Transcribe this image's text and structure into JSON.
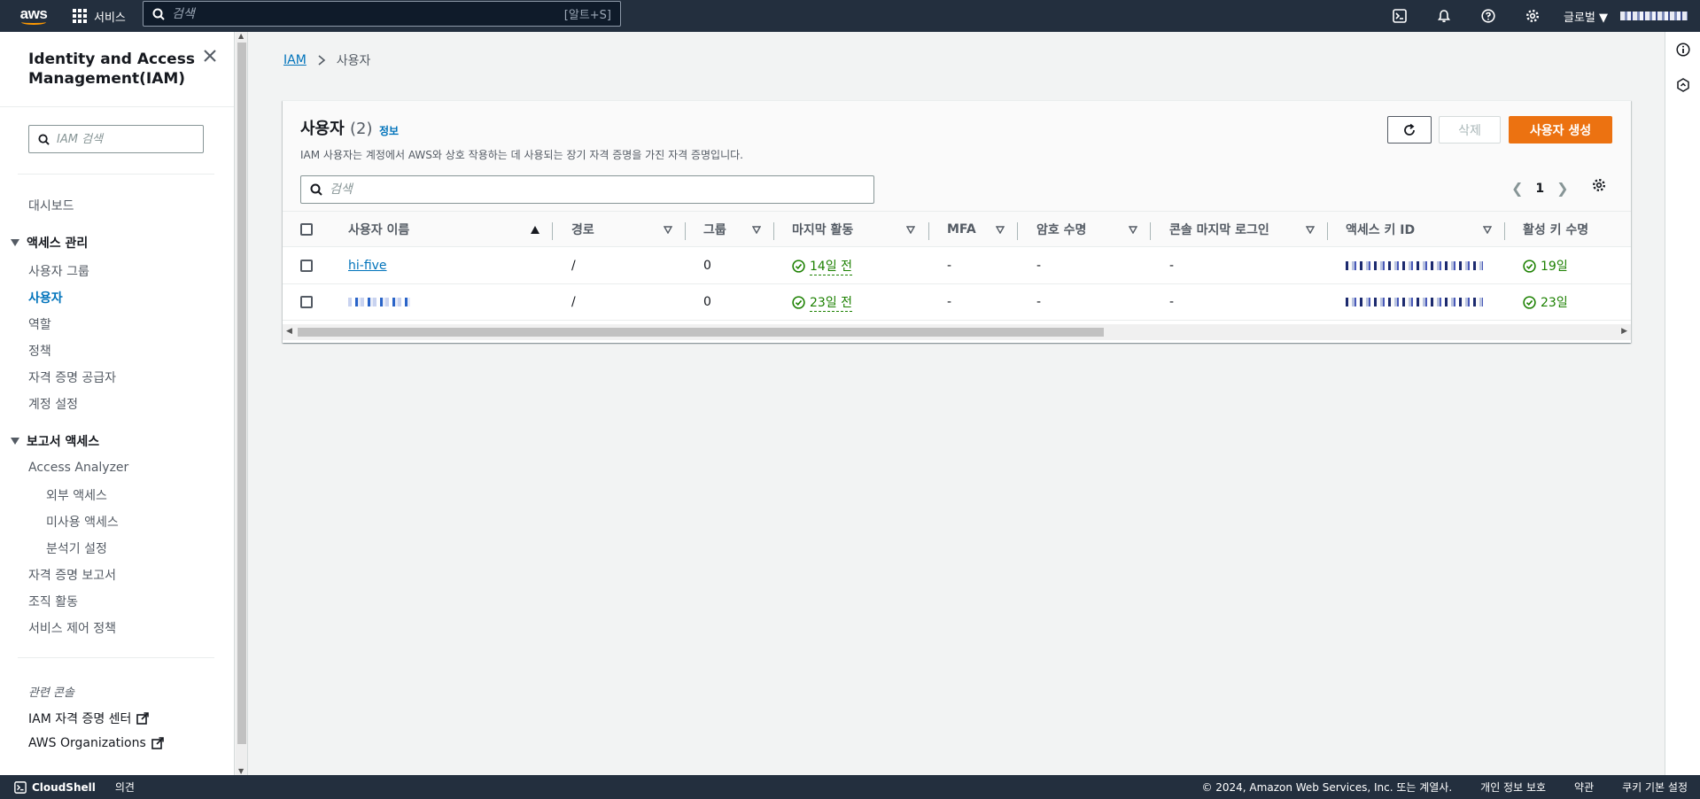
{
  "topnav": {
    "logo_text": "aws",
    "services_label": "서비스",
    "search_placeholder": "검색",
    "search_shortcut": "[알트+S]",
    "region_label": "글로벌 ▼"
  },
  "sidebar": {
    "title": "Identity and Access Management(IAM)",
    "search_placeholder": "IAM 검색",
    "dashboard": "대시보드",
    "access_section": "액세스 관리",
    "access_items": [
      "사용자 그룹",
      "사용자",
      "역할",
      "정책",
      "자격 증명 공급자",
      "계정 설정"
    ],
    "active_item": "사용자",
    "report_section": "보고서 액세스",
    "analyzer": "Access Analyzer",
    "analyzer_items": [
      "외부 액세스",
      "미사용 액세스",
      "분석기 설정"
    ],
    "report_items": [
      "자격 증명 보고서",
      "조직 활동",
      "서비스 제어 정책"
    ],
    "related_title": "관련 콘솔",
    "related_links": [
      "IAM 자격 증명 센터",
      "AWS Organizations"
    ]
  },
  "breadcrumb": {
    "root": "IAM",
    "current": "사용자"
  },
  "users_panel": {
    "title": "사용자",
    "count": "(2)",
    "info_link": "정보",
    "description": "IAM 사용자는 계정에서 AWS와 상호 작용하는 데 사용되는 장기 자격 증명을 가진 자격 증명입니다.",
    "delete_label": "삭제",
    "create_label": "사용자 생성",
    "search_placeholder": "검색",
    "current_page": "1",
    "columns": [
      "사용자 이름",
      "경로",
      "그룹",
      "마지막 활동",
      "MFA",
      "암호 수명",
      "콘솔 마지막 로그인",
      "액세스 키 ID",
      "활성 키 수명"
    ],
    "rows": [
      {
        "name": "hi-five",
        "path": "/",
        "groups": "0",
        "last_activity": "14일 전",
        "mfa": "-",
        "password_age": "-",
        "console_login": "-",
        "key_age": "19일"
      },
      {
        "name": "",
        "path": "/",
        "groups": "0",
        "last_activity": "23일 전",
        "mfa": "-",
        "password_age": "-",
        "console_login": "-",
        "key_age": "23일"
      }
    ]
  },
  "footer": {
    "cloudshell": "CloudShell",
    "feedback": "의견",
    "copyright": "© 2024, Amazon Web Services, Inc. 또는 계열사.",
    "privacy": "개인 정보 보호",
    "terms": "약관",
    "cookies": "쿠키 기본 설정"
  },
  "colors": {
    "nav_bg": "#232f3e",
    "accent": "#ec7211",
    "link": "#0073bb",
    "success": "#1d8102"
  }
}
